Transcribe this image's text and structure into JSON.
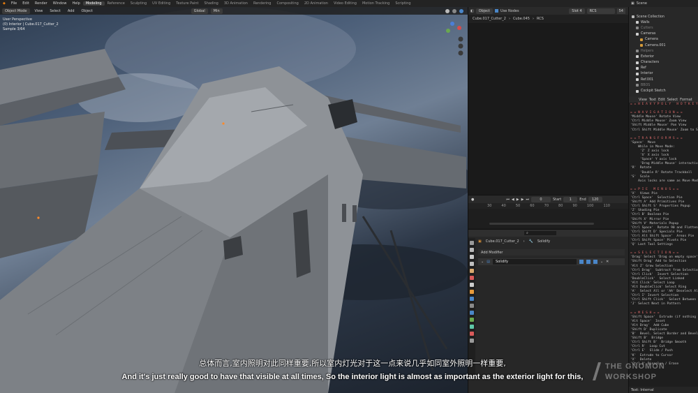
{
  "menu": {
    "items": [
      "File",
      "Edit",
      "Render",
      "Window",
      "Help"
    ],
    "workspaces": [
      "Modeling",
      "Reference",
      "Sculpting",
      "UV Editing",
      "Texture Paint",
      "Shading",
      "3D Animation",
      "Rendering",
      "Compositing",
      "2D Animation",
      "Video Editing",
      "Motion Tracking",
      "Scripting"
    ],
    "active_workspace": "Modeling",
    "scene_label": "Scene"
  },
  "viewport": {
    "mode": "Object Mode",
    "menus": [
      "View",
      "Select",
      "Add",
      "Object"
    ],
    "orientation": "Global",
    "pivot": "Min",
    "info": {
      "line1": "User Perspective",
      "line2": "(0) Interior | Cube.017_Cutter_2",
      "line3": "Sample 3/64"
    }
  },
  "mid_header": {
    "object_label": "Object",
    "use_nodes": "Use Nodes",
    "slot": "Slot 4",
    "material": "RCS",
    "count": "54"
  },
  "breadcrumb": [
    "Cube.017_Cutter_2",
    "Cube.045",
    "RCS"
  ],
  "timeline": {
    "frame": "0",
    "start_label": "Start",
    "start": "1",
    "end_label": "End",
    "end": "120",
    "ruler": [
      "30",
      "40",
      "50",
      "60",
      "70",
      "80",
      "90",
      "100",
      "110"
    ]
  },
  "properties": {
    "path_object": "Cube.017_Cutter_2",
    "path_modifier": "Solidify",
    "add_modifier": "Add Modifier",
    "modifier_name": "Solidify"
  },
  "outliner": {
    "rows": [
      {
        "label": "Scene Collection",
        "color": "#bbbbbb",
        "dim": false,
        "indent": 0
      },
      {
        "label": "Walls",
        "color": "#cfcfcf",
        "dim": false,
        "indent": 1
      },
      {
        "label": "Cutters",
        "color": "#8a8a8a",
        "dim": true,
        "indent": 1
      },
      {
        "label": "Cameras",
        "color": "#cfcfcf",
        "dim": false,
        "indent": 1
      },
      {
        "label": "Camera",
        "color": "#d49a3a",
        "dim": false,
        "indent": 2
      },
      {
        "label": "Camera.001",
        "color": "#d49a3a",
        "dim": false,
        "indent": 2
      },
      {
        "label": "Helpers",
        "color": "#8a8a8a",
        "dim": true,
        "indent": 1
      },
      {
        "label": "Exterior",
        "color": "#cfcfcf",
        "dim": false,
        "indent": 1
      },
      {
        "label": "Characters",
        "color": "#cfcfcf",
        "dim": false,
        "indent": 1
      },
      {
        "label": "Ref",
        "color": "#cfcfcf",
        "dim": false,
        "indent": 1
      },
      {
        "label": "Interior",
        "color": "#cfcfcf",
        "dim": false,
        "indent": 1
      },
      {
        "label": "Ref.001",
        "color": "#cfcfcf",
        "dim": false,
        "indent": 1
      },
      {
        "label": "BBOS",
        "color": "#8a8a8a",
        "dim": true,
        "indent": 1
      },
      {
        "label": "Cockpit Sketch",
        "color": "#cfcfcf",
        "dim": false,
        "indent": 1
      }
    ]
  },
  "text_editor": {
    "menus": [
      "View",
      "Text",
      "Edit",
      "Select",
      "Format"
    ],
    "footer": "Text: Internal",
    "lines": [
      {
        "t": "= = H E A V Y P O L Y   H O T K E Y S",
        "h": true
      },
      {
        "t": "",
        "h": false
      },
      {
        "t": "= = N A V I G A T I O N = =",
        "h": true
      },
      {
        "t": "'Middle Mouse' Rotate View",
        "h": false
      },
      {
        "t": "'Ctrl Middle Mouse' Zoom View",
        "h": false
      },
      {
        "t": "'Shift Middle Mouse' Pan View",
        "h": false
      },
      {
        "t": "'Ctrl Shift Middle Mouse' Zoom to Selection",
        "h": false
      },
      {
        "t": "",
        "h": false
      },
      {
        "t": "= = T R A N S F O R M S = =",
        "h": true
      },
      {
        "t": "'Space'  Move",
        "h": false
      },
      {
        "t": "    While in Move Mode:",
        "h": false
      },
      {
        "t": "     'Z' Z axis lock",
        "h": false
      },
      {
        "t": "     'X' X axis lock",
        "h": false
      },
      {
        "t": "     'Space' Y axis lock",
        "h": false
      },
      {
        "t": "     'Drag Middle Mouse' interactive axis",
        "h": false
      },
      {
        "t": "'R'  Rotate",
        "h": false
      },
      {
        "t": "     'Double R' Rotate Trackball",
        "h": false
      },
      {
        "t": "'S'  Scale",
        "h": false
      },
      {
        "t": "    Axis locks are same as Move Mode",
        "h": false
      },
      {
        "t": "",
        "h": false
      },
      {
        "t": "= = P I E   M E N U S = =",
        "h": true
      },
      {
        "t": "'X'  Views Pie",
        "h": false
      },
      {
        "t": "'Ctrl Space'  Selection Pie",
        "h": false
      },
      {
        "t": "'Shift A' Add Primitives Pie",
        "h": false
      },
      {
        "t": "'Ctrl Shift S' Properties Popup",
        "h": false
      },
      {
        "t": "'Z' Shading Pie",
        "h": false
      },
      {
        "t": "'Ctrl B' Boolean Pie",
        "h": false
      },
      {
        "t": "'Shift X' Mirror Pie",
        "h": false
      },
      {
        "t": "'Shift V' Materials Popup",
        "h": false
      },
      {
        "t": "'Ctrl Space'  Rotate 90 and Flatten",
        "h": false
      },
      {
        "t": "'Ctrl Shift D' Specials Pie",
        "h": false
      },
      {
        "t": "'Ctrl Alt Shift Space'  Areas Pie",
        "h": false
      },
      {
        "t": "'Ctrl Shift Space' Pivots Pie",
        "h": false
      },
      {
        "t": "'Q' Last Tool Settings",
        "h": false
      },
      {
        "t": "",
        "h": false
      },
      {
        "t": "= = S E L E C T I O N = =",
        "h": true
      },
      {
        "t": "'Drag' Select 'Drag on empty space' Deselect",
        "h": false
      },
      {
        "t": "'Shift Drag' Add to Selection",
        "h": false
      },
      {
        "t": "'Alt Z' Grow Selection",
        "h": false
      },
      {
        "t": "'Ctrl Drag'  Subtract from Selection",
        "h": false
      },
      {
        "t": "'Ctrl Click'  Invert Selection",
        "h": false
      },
      {
        "t": "'DoubleClick'  Select Linked",
        "h": false
      },
      {
        "t": "'Alt Click' Select Loop",
        "h": false
      },
      {
        "t": "'Alt DoubleClick' Select Ring",
        "h": false
      },
      {
        "t": "'A'  Select All or 'AA' Deselect All",
        "h": false
      },
      {
        "t": "'Ctrl I' Invert Selection",
        "h": false
      },
      {
        "t": "'Ctrl Shift Click'  Select Between",
        "h": false
      },
      {
        "t": "'J' Select Next in Pattern",
        "h": false
      },
      {
        "t": "",
        "h": false
      },
      {
        "t": "= = M E S H = =",
        "h": true
      },
      {
        "t": "'Shift Space'  Extrude (if nothing is",
        "h": false
      },
      {
        "t": "'Alt Space'  Inset",
        "h": false
      },
      {
        "t": "'Alt Drag'  Add Cube",
        "h": false
      },
      {
        "t": "'Shift D' Duplicate",
        "h": false
      },
      {
        "t": "'B'  Bevel. Select Border and Bevel fr",
        "h": false
      },
      {
        "t": "'Shift B'  Bridge",
        "h": false
      },
      {
        "t": "'Ctrl Shift B'  Bridge Smooth",
        "h": false
      },
      {
        "t": "'Ctrl R'  Loop Cut",
        "h": false
      },
      {
        "t": "'Ctrl E'  Slide / Push",
        "h": false
      },
      {
        "t": "'K'  Extrude to Cursor",
        "h": false
      },
      {
        "t": "'X'  Delete",
        "h": false
      },
      {
        "t": "'Ctrl X' Dissolve / Erase",
        "h": false
      }
    ]
  },
  "subtitles": {
    "cn": "总体而言,室内照明对此同样重要,所以室内灯光对于这一点来说几乎如同室外照明一样重要,",
    "en": "And it's just really good to have that visible at all times, So the interior light is almost as important as the exterior light for this,"
  },
  "watermark": {
    "line1": "THE GNOMON",
    "line2": "WORKSHOP"
  }
}
